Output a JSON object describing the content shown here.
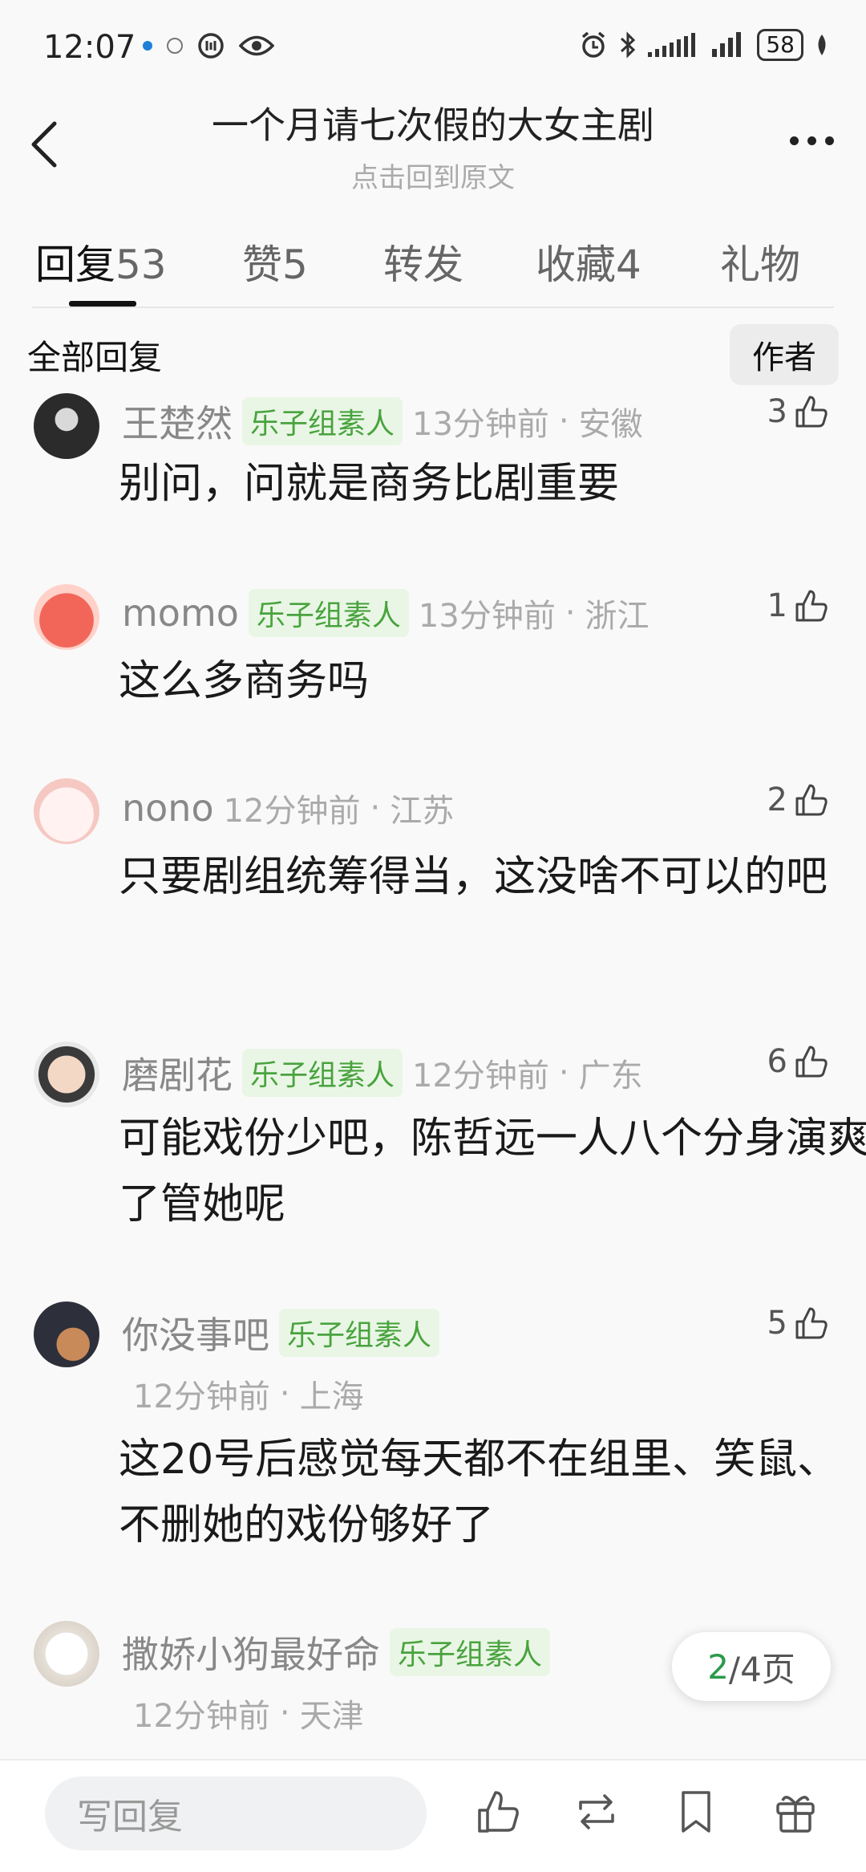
{
  "status_bar": {
    "time": "12:07",
    "battery": "58"
  },
  "header": {
    "title": "一个月请七次假的大女主剧",
    "subtitle": "点击回到原文"
  },
  "tabs": [
    {
      "label": "回复",
      "count": "53"
    },
    {
      "label": "赞",
      "count": "5"
    },
    {
      "label": "转发",
      "count": ""
    },
    {
      "label": "收藏",
      "count": "4"
    },
    {
      "label": "礼物",
      "count": ""
    }
  ],
  "filter": {
    "all_label": "全部回复",
    "author_label": "作者"
  },
  "comments": [
    {
      "name": "王楚然",
      "badge": "乐子组素人",
      "time": "13分钟前",
      "location": "安徽",
      "likes": "3",
      "text": "别问，问就是商务比剧重要"
    },
    {
      "name": "momo",
      "badge": "乐子组素人",
      "time": "13分钟前",
      "location": "浙江",
      "likes": "1",
      "text": "这么多商务吗"
    },
    {
      "name": "nono",
      "badge": "",
      "time": "12分钟前",
      "location": "江苏",
      "likes": "2",
      "text": "只要剧组统筹得当，这没啥不可以的吧"
    },
    {
      "name": "磨剧花",
      "badge": "乐子组素人",
      "time": "12分钟前",
      "location": "广东",
      "likes": "6",
      "text": "可能戏份少吧，陈哲远一人八个分身演爽了管她呢"
    },
    {
      "name": "你没事吧",
      "badge": "乐子组素人",
      "time": "12分钟前",
      "location": "上海",
      "likes": "5",
      "text": "这20号后感觉每天都不在组里、笑鼠、不删她的戏份够好了"
    },
    {
      "name": "撒娇小狗最好命",
      "badge": "乐子组素人",
      "time": "12分钟前",
      "location": "天津",
      "likes": "",
      "text": ""
    }
  ],
  "pager": {
    "current": "2",
    "total": "/4页"
  },
  "bottom_bar": {
    "reply_placeholder": "写回复"
  },
  "colors": {
    "accent_green": "#2a9a4c",
    "badge_green": "#49a33e"
  }
}
